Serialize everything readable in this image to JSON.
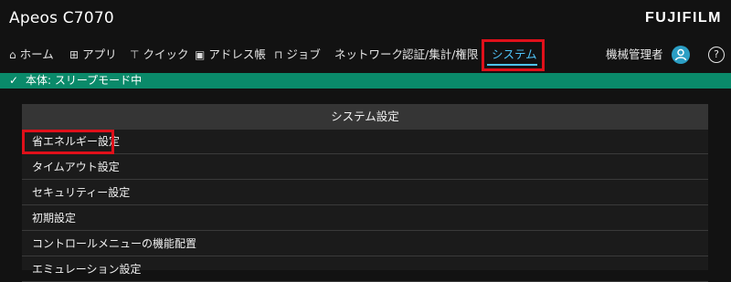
{
  "app": {
    "title": "Apeos C7070",
    "brand": "FUJIFILM"
  },
  "nav": {
    "items": [
      {
        "icon": "home-icon",
        "glyph": "⌂",
        "label": "ホーム"
      },
      {
        "icon": "apps-icon",
        "glyph": "⊞",
        "label": "アプリ"
      },
      {
        "icon": "quick-icon",
        "glyph": "⊤",
        "label": "クイック"
      },
      {
        "icon": "address-book-icon",
        "glyph": "▣",
        "label": "アドレス帳"
      },
      {
        "icon": "job-icon",
        "glyph": "⊓",
        "label": "ジョブ"
      },
      {
        "label": "ネットワーク"
      },
      {
        "label": "認証/集計/権限"
      },
      {
        "label": "システム",
        "active": true
      }
    ],
    "admin_label": "機械管理者",
    "help_symbol": "?"
  },
  "status": {
    "check": "✓",
    "text": "本体: スリープモード中"
  },
  "panel": {
    "title": "システム設定",
    "rows": [
      "省エネルギー設定",
      "タイムアウト設定",
      "セキュリティー設定",
      "初期設定",
      "コントロールメニューの機能配置",
      "エミュレーション設定"
    ]
  },
  "colors": {
    "accent": "#4fc3f7",
    "status_bar": "#0a8a6a",
    "highlight": "#e0101a",
    "avatar": "#2b9ec4"
  }
}
